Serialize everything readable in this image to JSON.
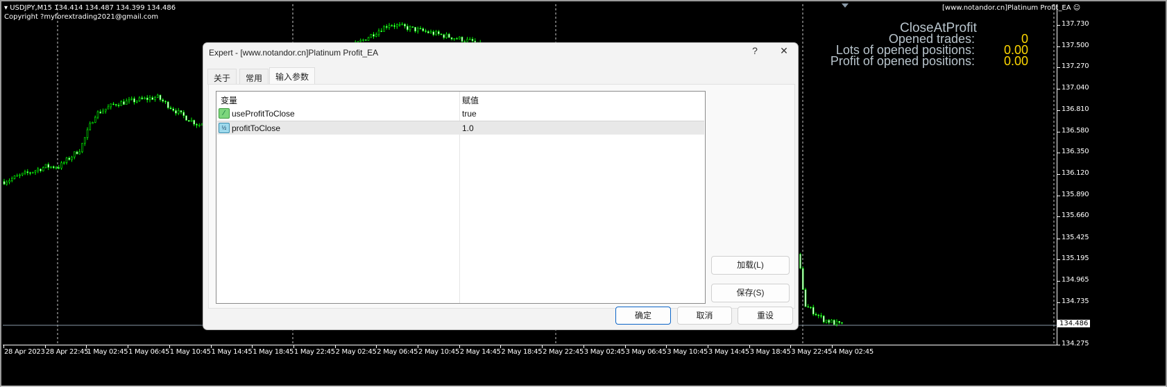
{
  "chart": {
    "symbol_line": "USDJPY,M15  134.414 134.487 134.399 134.486",
    "copyright": "Copyright ?myforextrading2021@gmail.com",
    "ea_label": "[www.notandor.cn]Platinum Profit_EA",
    "price_ticks": [
      "137.730",
      "137.500",
      "137.270",
      "137.040",
      "136.810",
      "136.580",
      "136.350",
      "136.120",
      "135.890",
      "135.660",
      "135.425",
      "135.195",
      "134.965",
      "134.735",
      "134.275"
    ],
    "current_price": "134.486",
    "time_ticks": [
      "28 Apr 2023",
      "28 Apr 22:45",
      "1 May 02:45",
      "1 May 06:45",
      "1 May 10:45",
      "1 May 14:45",
      "1 May 18:45",
      "1 May 22:45",
      "2 May 02:45",
      "2 May 06:45",
      "2 May 10:45",
      "2 May 14:45",
      "2 May 18:45",
      "2 May 22:45",
      "3 May 02:45",
      "3 May 06:45",
      "3 May 10:45",
      "3 May 14:45",
      "3 May 18:45",
      "3 May 22:45",
      "4 May 02:45"
    ],
    "price_path_hours_price": [
      [
        0,
        136.04
      ],
      [
        4,
        136.2
      ],
      [
        5.3,
        136.2
      ],
      [
        7.3,
        136.39
      ],
      [
        8.7,
        136.76
      ],
      [
        10.7,
        136.88
      ],
      [
        14.7,
        136.95
      ],
      [
        17,
        136.76
      ],
      [
        18.7,
        136.65
      ],
      [
        27.7,
        137.1
      ],
      [
        37,
        137.74
      ],
      [
        45,
        137.55
      ],
      [
        76.3,
        135.23
      ],
      [
        77,
        134.7
      ],
      [
        78.7,
        134.55
      ],
      [
        80.7,
        134.48
      ]
    ],
    "candle_color": "#00ff00",
    "overlay": {
      "title": "CloseAtProfit",
      "rows": [
        {
          "label": "Opened trades:",
          "value": "0"
        },
        {
          "label": "Lots of opened positions:",
          "value": "0.00"
        },
        {
          "label": "Profit of opened positions:",
          "value": "0.00"
        }
      ]
    }
  },
  "dialog": {
    "title": "Expert - [www.notandor.cn]Platinum Profit_EA",
    "help": "?",
    "close": "✕",
    "tabs": [
      "关于",
      "常用",
      "输入参数"
    ],
    "columns": [
      "变量",
      "赋值"
    ],
    "params": [
      {
        "name": "useProfitToClose",
        "value": "true",
        "icon": "bool-icon"
      },
      {
        "name": "profitToClose",
        "value": "1.0",
        "icon": "double-icon"
      }
    ],
    "load": "加载(L)",
    "save": "保存(S)",
    "ok": "确定",
    "cancel": "取消",
    "reset": "重设"
  }
}
